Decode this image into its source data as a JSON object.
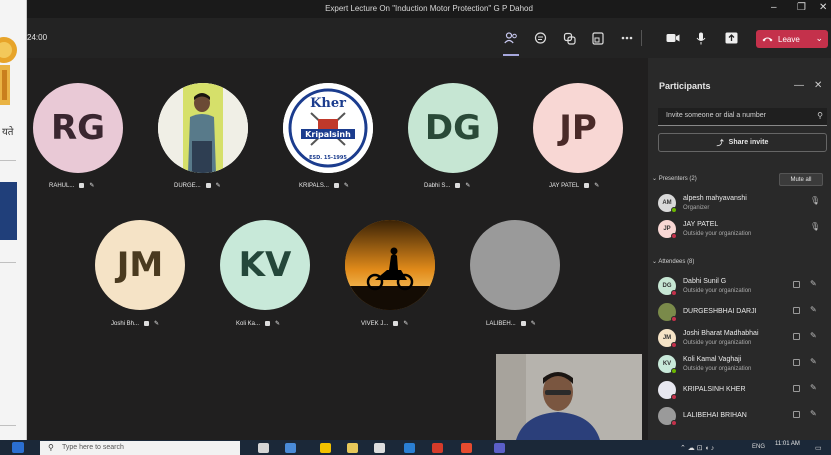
{
  "window": {
    "title": "Expert Lecture On \"Induction Motor Protection\" G P Dahod"
  },
  "background_app": {
    "fragment_text": "यते"
  },
  "toolbar": {
    "timer": "24:00",
    "leave_label": "Leave",
    "icons": [
      "people-icon",
      "chat-icon",
      "reactions-icon",
      "rooms-icon",
      "more-icon",
      "camera-icon",
      "mic-icon",
      "share-icon"
    ]
  },
  "stage": {
    "row1": [
      {
        "initials": "RG",
        "label": "RAHUL...",
        "bg": "#e9c9d6",
        "fg": "#3a2630"
      },
      {
        "initials": "",
        "label": "DURGE...",
        "bg": "#ffffff",
        "photo": "person-photo"
      },
      {
        "initials": "",
        "label": "KRIPALS...",
        "bg": "#ffffff",
        "photo": "logo"
      },
      {
        "initials": "DG",
        "label": "Dabhi S...",
        "bg": "#c6e6d3",
        "fg": "#2a4a38"
      },
      {
        "initials": "JP",
        "label": "JAY PATEL",
        "bg": "#f8d7d4",
        "fg": "#4a2a28"
      }
    ],
    "row2": [
      {
        "initials": "JM",
        "label": "Joshi Bh...",
        "bg": "#f5e3c6",
        "fg": "#4a3a1f"
      },
      {
        "initials": "KV",
        "label": "Koli Ka...",
        "bg": "#c8e9d9",
        "fg": "#24473a"
      },
      {
        "initials": "",
        "label": "VIVEK J...",
        "bg": "#d48a23",
        "photo": "sunset-biker"
      },
      {
        "initials": "",
        "label": "LALIBEH...",
        "bg": "#9a9a9a"
      }
    ],
    "logo_text_top": "Kher",
    "logo_text_mid": "Kripalsinh",
    "logo_text_bottom": "ESD. 15-1995"
  },
  "panel": {
    "title": "Participants",
    "invite_placeholder": "Invite someone or dial a number",
    "share_invite": "Share invite",
    "presenters_header": "Presenters (2)",
    "mute_all": "Mute all",
    "attendees_header": "Attendees (8)",
    "presenters": [
      {
        "initials": "AM",
        "name": "alpesh mahyavanshi",
        "sub": "Organizer",
        "bg": "#d9d9d9",
        "dot": "#6bb700"
      },
      {
        "initials": "JP",
        "name": "JAY PATEL",
        "sub": "Outside your organization",
        "bg": "#f8d7d4",
        "dot": "#c4314b"
      }
    ],
    "attendees": [
      {
        "initials": "DG",
        "name": "Dabhi Sunil G",
        "sub": "Outside your organization",
        "bg": "#c6e6d3",
        "dot": "#c4314b"
      },
      {
        "initials": "",
        "name": "DURGESHBHAI DARJI",
        "sub": "",
        "bg": "#7a8a4a",
        "dot": "#c4314b"
      },
      {
        "initials": "JM",
        "name": "Joshi Bharat Madhabhai",
        "sub": "Outside your organization",
        "bg": "#f5e3c6",
        "dot": "#c4314b"
      },
      {
        "initials": "KV",
        "name": "Koli Kamal Vaghaji",
        "sub": "Outside your organization",
        "bg": "#c8e9d9",
        "dot": "#6bb700"
      },
      {
        "initials": "",
        "name": "KRIPALSINH KHER",
        "sub": "",
        "bg": "#e8e8f0",
        "dot": "#c4314b"
      },
      {
        "initials": "",
        "name": "LALIBEHAI BRIHAN",
        "sub": "",
        "bg": "#9a9a9a",
        "dot": "#c4314b"
      }
    ]
  },
  "taskbar": {
    "search_placeholder": "Type here to search",
    "time": "11:01 AM",
    "lang": "ENG"
  }
}
